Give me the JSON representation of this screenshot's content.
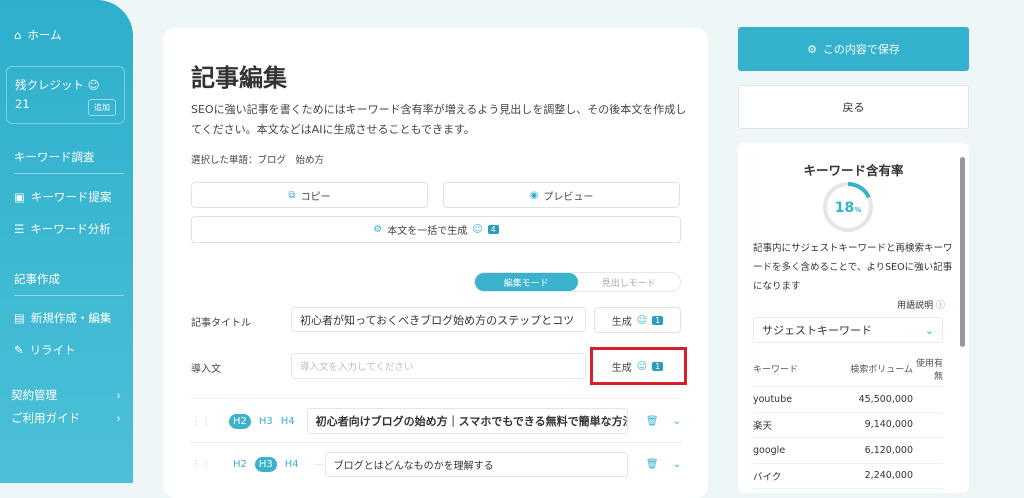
{
  "sidebar": {
    "home": "ホーム",
    "credit_label": "残クレジット",
    "credit_value": "21",
    "add": "追加",
    "section_keyword": "キーワード調査",
    "keyword_suggest": "キーワード提案",
    "keyword_analysis": "キーワード分析",
    "section_article": "記事作成",
    "new_edit": "新規作成・編集",
    "rewrite": "リライト",
    "contract": "契約管理",
    "guide": "ご利用ガイド"
  },
  "main": {
    "title": "記事編集",
    "description": "SEOに強い記事を書くためにはキーワード含有率が増えるよう見出しを調整し、その後本文を作成してください。本文などはAIに生成させることもできます。",
    "selected_words": "選択した単語：ブログ　始め方",
    "copy": "コピー",
    "preview": "プレビュー",
    "bulk_generate": "本文を一括で生成",
    "bulk_cost": "4",
    "mode_edit": "編集モード",
    "mode_heading": "見出しモード",
    "article_title_label": "記事タイトル",
    "article_title_value": "初心者が知っておくべきブログ始め方のステップとコツ",
    "generate": "生成",
    "generate_cost": "1",
    "intro_label": "導入文",
    "intro_placeholder": "導入文を入力してください",
    "headings": [
      {
        "level": "H2",
        "text": "初心者向けブログの始め方｜スマホでもできる無料で簡単な方法"
      },
      {
        "level": "H3",
        "text": "ブログとはどんなものかを理解する"
      }
    ]
  },
  "right": {
    "save": "この内容で保存",
    "back": "戻る",
    "kw_title": "キーワード含有率",
    "rate": "18",
    "rate_unit": "%",
    "rate_fraction": 0.18,
    "kw_desc": "記事内にサジェストキーワードと再検索キーワードを多く含めることで、よりSEOに強い記事になります",
    "term_help": "用語説明",
    "dropdown": "サジェストキーワード",
    "col_keyword": "キーワード",
    "col_volume": "検索ボリューム",
    "col_used": "使用有無",
    "rows": [
      {
        "kw": "youtube",
        "vol": "45,500,000"
      },
      {
        "kw": "楽天",
        "vol": "9,140,000"
      },
      {
        "kw": "google",
        "vol": "6,120,000"
      },
      {
        "kw": "バイク",
        "vol": "2,240,000"
      }
    ]
  },
  "colors": {
    "accent": "#33b1cd",
    "highlight": "#d9202a"
  }
}
